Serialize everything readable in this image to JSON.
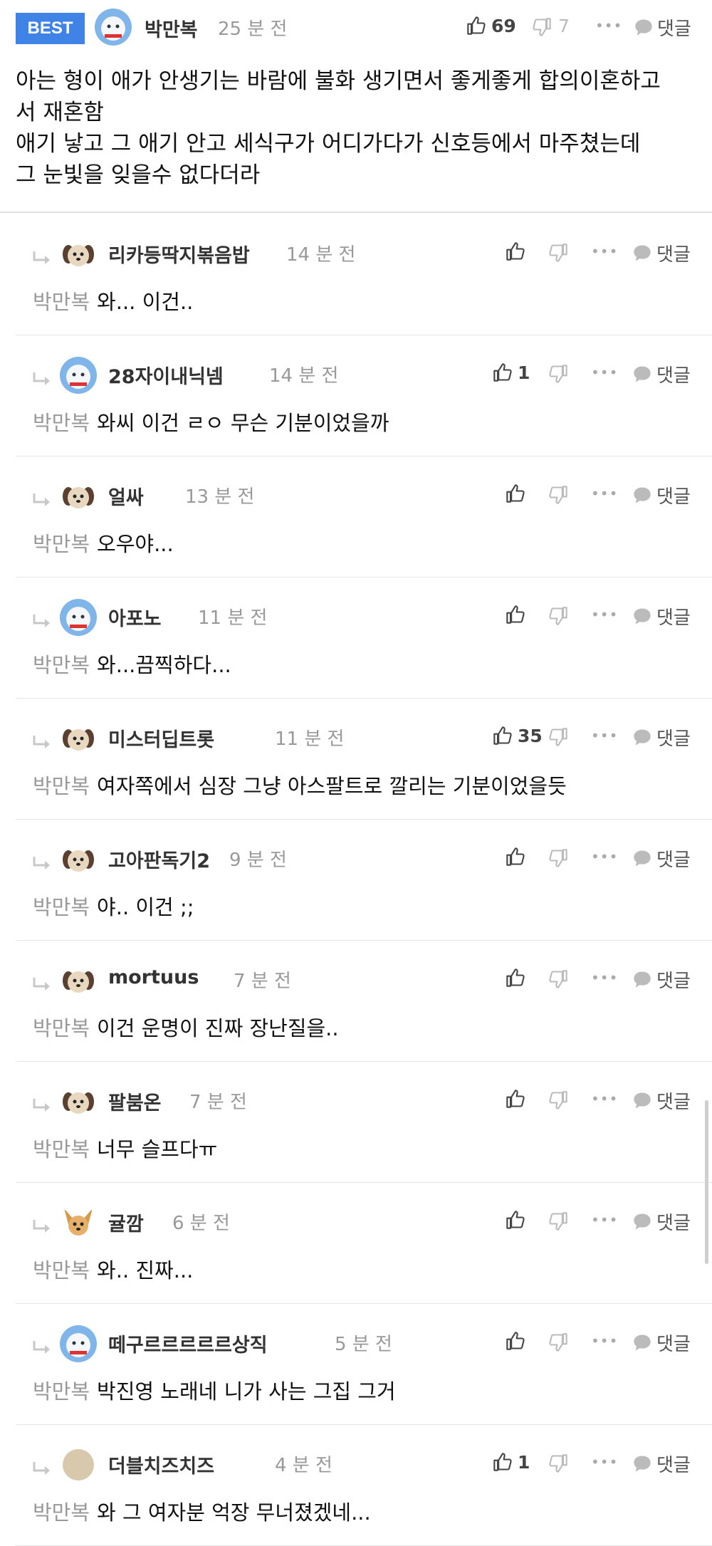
{
  "best": {
    "badge": "BEST",
    "nickname": "박만복",
    "time": "25 분 전",
    "likes": "69",
    "dislikes": "7",
    "reply_label": "댓글",
    "body_lines": [
      "아는 형이 애가 안생기는 바람에 불화 생기면서 좋게좋게 합의이혼하고",
      "서 재혼함",
      "애기 낳고 그 애기 안고 세식구가 어디가다가 신호등에서 마주쳤는데",
      "그 눈빛을 잊을수 없다더라"
    ]
  },
  "replies": [
    {
      "nickname": "리카등딱지볶음밥",
      "time": "14 분 전",
      "likes": "",
      "mention": "박만복",
      "text": "와... 이건..",
      "reply_label": "댓글"
    },
    {
      "nickname": "28자이내닉넴",
      "time": "14 분 전",
      "likes": "1",
      "mention": "박만복",
      "text": "와씨 이건 ㄹㅇ 무슨 기분이었을까",
      "reply_label": "댓글"
    },
    {
      "nickname": "얼싸",
      "time": "13 분 전",
      "likes": "",
      "mention": "박만복",
      "text": "오우야...",
      "reply_label": "댓글"
    },
    {
      "nickname": "아포노",
      "time": "11 분 전",
      "likes": "",
      "mention": "박만복",
      "text": "와...끔찍하다...",
      "reply_label": "댓글"
    },
    {
      "nickname": "미스터딥트롯",
      "time": "11 분 전",
      "likes": "35",
      "mention": "박만복",
      "text": "여자쪽에서 심장 그냥 아스팔트로 깔리는 기분이었을듯",
      "reply_label": "댓글"
    },
    {
      "nickname": "고아판독기2",
      "time": "9 분 전",
      "likes": "",
      "mention": "박만복",
      "text": "야.. 이건 ;;",
      "reply_label": "댓글"
    },
    {
      "nickname": "mortuus",
      "time": "7 분 전",
      "likes": "",
      "mention": "박만복",
      "text": "이건 운명이 진짜 장난질을..",
      "reply_label": "댓글"
    },
    {
      "nickname": "팔붐온",
      "time": "7 분 전",
      "likes": "",
      "mention": "박만복",
      "text": "너무 슬프다ㅠ",
      "reply_label": "댓글"
    },
    {
      "nickname": "귤깜",
      "time": "6 분 전",
      "likes": "",
      "mention": "박만복",
      "text": "와.. 진짜...",
      "reply_label": "댓글"
    },
    {
      "nickname": "떼구르르르르르상직",
      "time": "5 분 전",
      "likes": "",
      "mention": "박만복",
      "text": "박진영 노래네 니가 사는 그집 그거",
      "reply_label": "댓글"
    },
    {
      "nickname": "더블치즈치즈",
      "time": "4 분 전",
      "likes": "1",
      "mention": "박만복",
      "text": "와 그 여자분 억장 무너졌겠네...",
      "reply_label": "댓글"
    }
  ],
  "avatar_icons": [
    "snowman-avatar-icon",
    "puppy-avatar-icon",
    "snowman-avatar-icon",
    "puppy-avatar-icon",
    "snowman-avatar-icon",
    "puppy-avatar-icon",
    "puppy-avatar-icon",
    "puppy-avatar-icon",
    "puppy-avatar-icon",
    "chihuahua-avatar-icon",
    "snowman-avatar-icon",
    "beige-circle-avatar-icon"
  ],
  "colors": {
    "badge": "#3f83e6",
    "meta": "#999999",
    "mention": "#999999"
  }
}
